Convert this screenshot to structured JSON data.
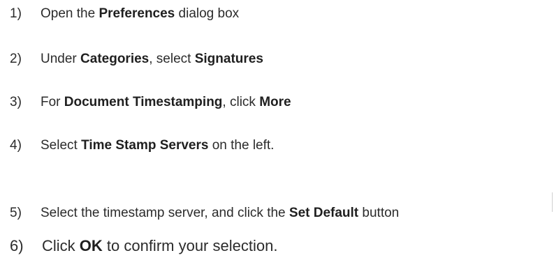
{
  "steps": [
    {
      "number": "1)",
      "parts": [
        "Open the ",
        "Preferences",
        " dialog box"
      ]
    },
    {
      "number": "2)",
      "parts": [
        "Under ",
        "Categories",
        ", select ",
        "Signatures"
      ]
    },
    {
      "number": "3)",
      "parts": [
        "For ",
        "Document Timestamping",
        ", click ",
        "More"
      ]
    },
    {
      "number": "4)",
      "parts": [
        "Select ",
        "Time Stamp Servers",
        " on the left."
      ]
    },
    {
      "number": "5)",
      "parts": [
        "Select the timestamp server, and click the ",
        "Set Default",
        " button"
      ]
    },
    {
      "number": "6)",
      "parts": [
        "Click ",
        "OK",
        " to confirm your selection."
      ]
    }
  ]
}
